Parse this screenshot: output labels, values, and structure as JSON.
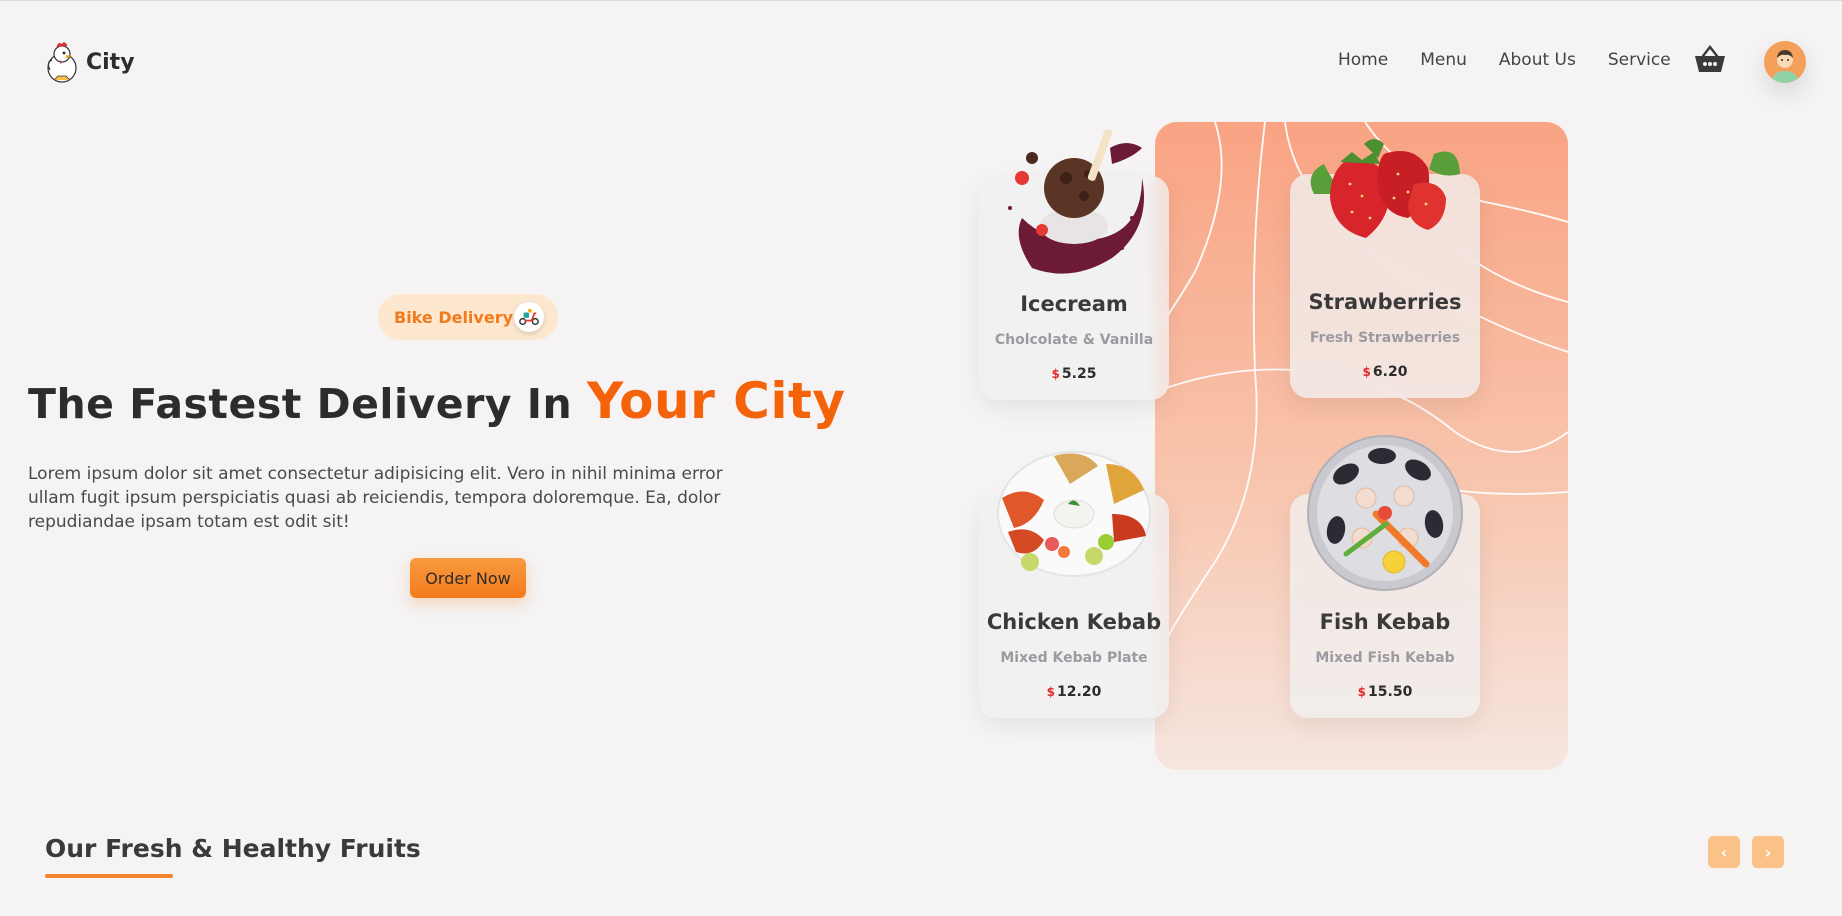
{
  "brand": {
    "name": "City",
    "logo_icon": "rooster-mascot-icon"
  },
  "nav": {
    "items": [
      "Home",
      "Menu",
      "About Us",
      "Service"
    ],
    "cart_icon": "basket-icon",
    "avatar_icon": "user-avatar-icon"
  },
  "hero": {
    "badge_label": "Bike Delivery",
    "badge_icon": "scooter-icon",
    "title_main": "The Fastest Delivery In",
    "title_accent": "Your City",
    "description": "Lorem ipsum dolor sit amet consectetur adipisicing elit. Vero in nihil minima error ullam fugit ipsum perspiciatis quasi ab reiciendis, tempora doloremque. Ea, dolor repudiandae ipsam totam est odit sit!",
    "cta_label": "Order Now"
  },
  "products": [
    {
      "name": "Icecream",
      "subtitle": "Cholcolate & Vanilla",
      "currency": "$",
      "price": "5.25",
      "image_icon": "icecream-sundae-icon"
    },
    {
      "name": "Strawberries",
      "subtitle": "Fresh Strawberries",
      "currency": "$",
      "price": "6.20",
      "image_icon": "strawberries-icon"
    },
    {
      "name": "Chicken Kebab",
      "subtitle": "Mixed Kebab Plate",
      "currency": "$",
      "price": "12.20",
      "image_icon": "kebab-plate-icon"
    },
    {
      "name": "Fish Kebab",
      "subtitle": "Mixed Fish Kebab",
      "currency": "$",
      "price": "15.50",
      "image_icon": "seafood-platter-icon"
    }
  ],
  "section": {
    "title": "Our Fresh & Healthy Fruits",
    "prev_icon": "chevron-left-icon",
    "next_icon": "chevron-right-icon",
    "prev_glyph": "‹",
    "next_glyph": "›"
  },
  "colors": {
    "accent": "#f4620a",
    "accent_light": "#fbc287",
    "panel_top": "#f9a383",
    "background": "#f5f3f3"
  }
}
